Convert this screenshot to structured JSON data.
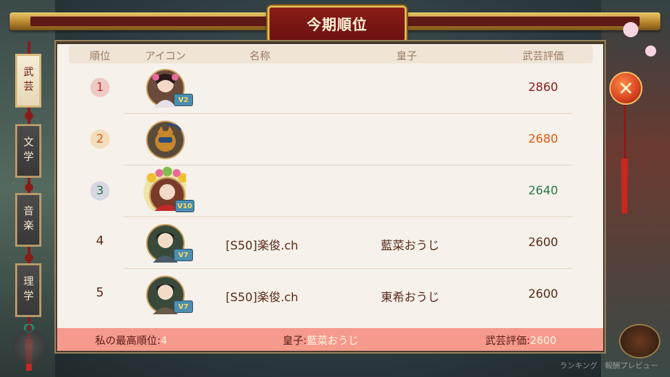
{
  "title": "今期順位",
  "tabs": [
    {
      "label": "武芸",
      "active": true
    },
    {
      "label": "文学",
      "active": false
    },
    {
      "label": "音楽",
      "active": false
    },
    {
      "label": "理学",
      "active": false
    }
  ],
  "headers": {
    "rank": "順位",
    "icon": "アイコン",
    "name": "名称",
    "prince": "皇子",
    "score": "武芸評価"
  },
  "rows": [
    {
      "rank": "1",
      "vip": "V2",
      "name": "",
      "prince": "",
      "score": "2860",
      "rank_color": "#e07a7a",
      "score_color": "#8a1a1a"
    },
    {
      "rank": "2",
      "vip": "",
      "name": "",
      "prince": "",
      "score": "2680",
      "rank_color": "#f0b860",
      "score_color": "#e05a10"
    },
    {
      "rank": "3",
      "vip": "V10",
      "name": "",
      "prince": "",
      "score": "2640",
      "rank_color": "#9aa6d8",
      "score_color": "#2a7a4a"
    },
    {
      "rank": "4",
      "vip": "V7",
      "name": "[S50]楽俊.ch",
      "prince": "藍菜おうじ",
      "score": "2600",
      "score_color": "#5a2a1a"
    },
    {
      "rank": "5",
      "vip": "V7",
      "name": "[S50]楽俊.ch",
      "prince": "東希おうじ",
      "score": "2600",
      "score_color": "#5a2a1a"
    }
  ],
  "footer": {
    "best_rank_label": "私の最高順位:",
    "best_rank_value": "4",
    "prince_label": "皇子:",
    "prince_value": "藍菜おうじ",
    "score_label": "武芸評価:",
    "score_value": "2600"
  },
  "close_icon": "close-icon",
  "bottom_right_text": "ランキング　報酬プレビュー"
}
